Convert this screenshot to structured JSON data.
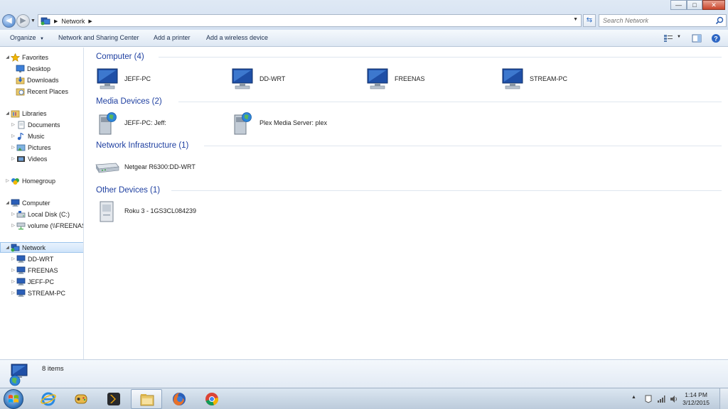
{
  "window": {
    "minimize_glyph": "—",
    "maximize_glyph": "□",
    "close_glyph": "✕"
  },
  "address_bar": {
    "crumbs": [
      "Network"
    ],
    "location_icon": "network-icon"
  },
  "search": {
    "placeholder": "Search Network"
  },
  "toolbar": {
    "organize_label": "Organize",
    "network_sharing_label": "Network and Sharing Center",
    "add_printer_label": "Add a printer",
    "add_wireless_label": "Add a wireless device"
  },
  "nav": {
    "favorites": {
      "label": "Favorites",
      "items": [
        "Desktop",
        "Downloads",
        "Recent Places"
      ]
    },
    "libraries": {
      "label": "Libraries",
      "items": [
        "Documents",
        "Music",
        "Pictures",
        "Videos"
      ]
    },
    "homegroup": {
      "label": "Homegroup"
    },
    "computer": {
      "label": "Computer",
      "items": [
        "Local Disk (C:)",
        "volume (\\\\FREENAS)"
      ]
    },
    "network": {
      "label": "Network",
      "items": [
        "DD-WRT",
        "FREENAS",
        "JEFF-PC",
        "STREAM-PC"
      ]
    }
  },
  "groups": [
    {
      "title": "Computer (4)",
      "items": [
        "JEFF-PC",
        "DD-WRT",
        "FREENAS",
        "STREAM-PC"
      ],
      "icon": "computer-icon"
    },
    {
      "title": "Media Devices (2)",
      "items": [
        "JEFF-PC: Jeff:",
        "Plex Media Server: plex"
      ],
      "icon": "media-device-icon"
    },
    {
      "title": "Network Infrastructure (1)",
      "items": [
        "Netgear R6300:DD-WRT"
      ],
      "icon": "router-icon"
    },
    {
      "title": "Other Devices (1)",
      "items": [
        "Roku 3 - 1GS3CL084239"
      ],
      "icon": "device-icon"
    }
  ],
  "details": {
    "count": "8 items"
  },
  "taskbar": {
    "apps": [
      "internet-explorer-icon",
      "games-icon",
      "plex-icon",
      "windows-explorer-icon",
      "firefox-icon",
      "chrome-icon"
    ],
    "clock_time": "1:14 PM",
    "clock_date": "3/12/2015"
  },
  "colors": {
    "group_header": "#1e3fa0",
    "selection": "#cfe4fa",
    "toolbar": "#dde7f3"
  }
}
